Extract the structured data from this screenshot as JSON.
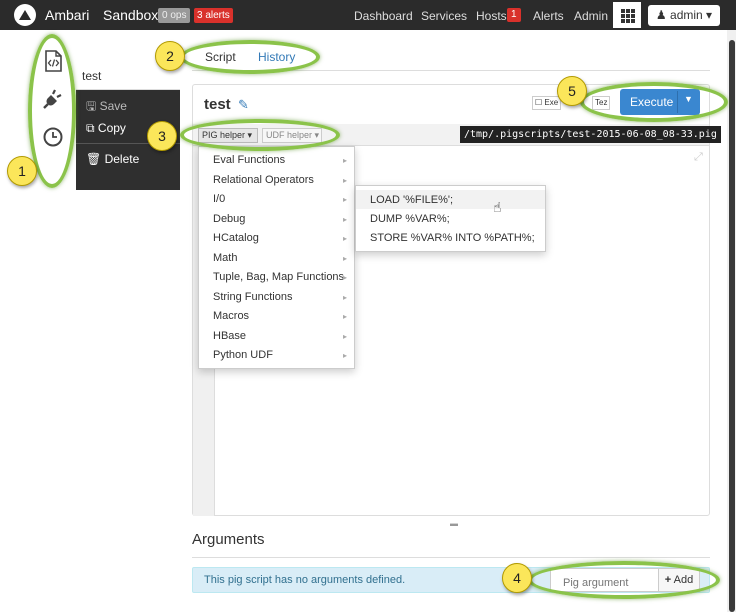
{
  "navbar": {
    "brand": "Ambari",
    "cluster": "Sandbox",
    "ops_badge": "0 ops",
    "alerts_badge": "3 alerts",
    "links": [
      "Dashboard",
      "Services",
      "Hosts",
      "Alerts",
      "Admin"
    ],
    "hosts_count": "1",
    "user": "admin"
  },
  "rail": {
    "icons": [
      "script-file-icon",
      "plug-icon",
      "clock-icon"
    ]
  },
  "script_menu": {
    "name": "test",
    "save": "Save",
    "copy": "Copy",
    "delete": "Delete"
  },
  "tabs": {
    "script": "Script",
    "history": "History"
  },
  "editor": {
    "title": "test",
    "explain": "Exe",
    "tez": "Tez",
    "execute": "Execute",
    "pig_helper": "PIG helper",
    "udf_helper": "UDF helper",
    "path": "/tmp/.pigscripts/test-2015-06-08_08-33.pig"
  },
  "pig_menu": [
    "Eval Functions",
    "Relational Operators",
    "I/0",
    "Debug",
    "HCatalog",
    "Math",
    "Tuple, Bag, Map Functions",
    "String Functions",
    "Macros",
    "HBase",
    "Python UDF"
  ],
  "io_submenu": [
    "LOAD '%FILE%';",
    "DUMP %VAR%;",
    "STORE %VAR% INTO %PATH%;"
  ],
  "arguments": {
    "title": "Arguments",
    "empty_text": "This pig script has no arguments defined.",
    "placeholder": "Pig argument",
    "add": "Add"
  },
  "callouts": [
    "1",
    "2",
    "3",
    "4",
    "5"
  ],
  "colors": {
    "accent": "#3a87d0",
    "callout_ring": "#8bc34a",
    "callout_badge": "#fbe65a",
    "navbar": "#2b2b2b",
    "alert": "#d9312b"
  }
}
